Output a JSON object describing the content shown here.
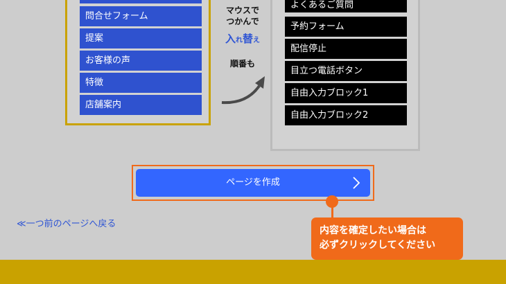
{
  "left_list": {
    "items": [
      "問合せフォーム",
      "提案",
      "お客様の声",
      "特徴",
      "店舗案内"
    ]
  },
  "instruction": {
    "line1": "マウスで",
    "line2": "つかんで",
    "irekae_big1": "入",
    "irekae_small": "れ",
    "irekae_big2": "替",
    "irekae_small2": "え",
    "line3": "順番も"
  },
  "right_list": {
    "items": [
      "よくあるご質問",
      "予約フォーム",
      "配信停止",
      "目立つ電話ボタン",
      "自由入力ブロック1",
      "自由入力ブロック2"
    ]
  },
  "create_button": {
    "label": "ページを作成"
  },
  "back_link": {
    "label": "≪一つ前のページへ戻る"
  },
  "callout": {
    "line1": "内容を確定したい場合は",
    "line2": "必ずクリックしてください"
  },
  "colors": {
    "accent_blue": "#3366ff",
    "item_blue": "#2f52cf",
    "orange": "#f06a1a",
    "gold": "#c9a200"
  }
}
